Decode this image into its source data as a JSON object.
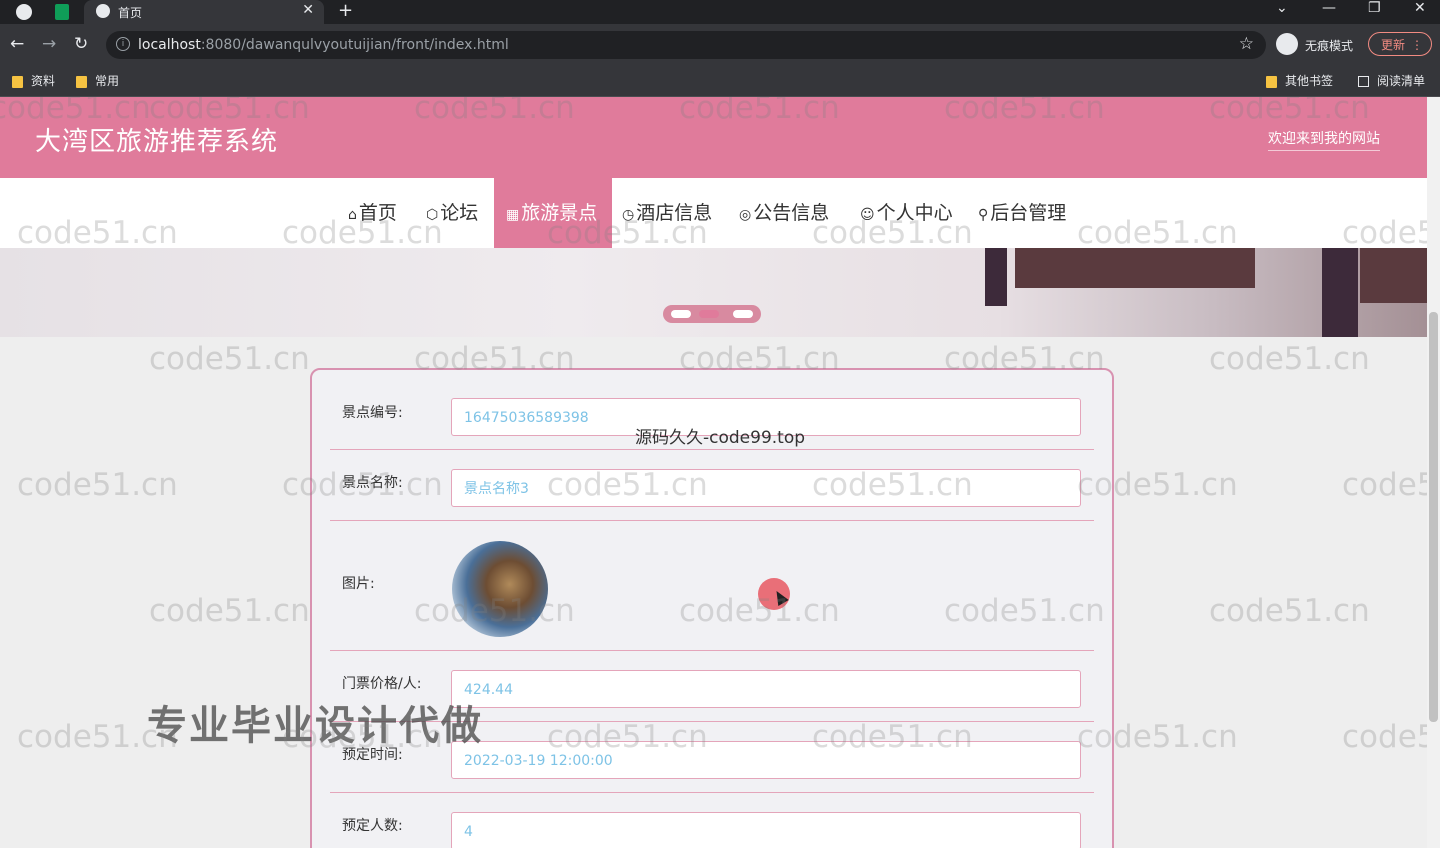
{
  "browser": {
    "tab_title": "首页",
    "url_host": "localhost",
    "url_rest": ":8080/dawanqulvyoutuijian/front/index.html",
    "incognito_label": "无痕模式",
    "update_label": "更新",
    "bookmarks": [
      "资料",
      "常用"
    ],
    "bookmarks_right": [
      "其他书签",
      "阅读清单"
    ]
  },
  "site": {
    "title": "大湾区旅游推荐系统",
    "welcome": "欢迎来到我的网站"
  },
  "nav": [
    {
      "label": "首页",
      "icon": "⌂"
    },
    {
      "label": "论坛",
      "icon": "⬡"
    },
    {
      "label": "旅游景点",
      "icon": "▦"
    },
    {
      "label": "酒店信息",
      "icon": "◷"
    },
    {
      "label": "公告信息",
      "icon": "◎"
    },
    {
      "label": "个人中心",
      "icon": "☺"
    },
    {
      "label": "后台管理",
      "icon": "⚲"
    }
  ],
  "nav_active": "旅游景点",
  "form": {
    "fields": [
      {
        "label": "景点编号:",
        "value": "16475036589398"
      },
      {
        "label": "景点名称:",
        "value": "景点名称3"
      },
      {
        "label": "图片:",
        "value": ""
      },
      {
        "label": "门票价格/人:",
        "value": "424.44"
      },
      {
        "label": "预定时间:",
        "value": "2022-03-19 12:00:00"
      },
      {
        "label": "预定人数:",
        "value": "4"
      }
    ]
  },
  "overlay_text": "源码久久-code99.top",
  "promo_text": "专业毕业设计代做",
  "watermark_text": "code51.cn"
}
